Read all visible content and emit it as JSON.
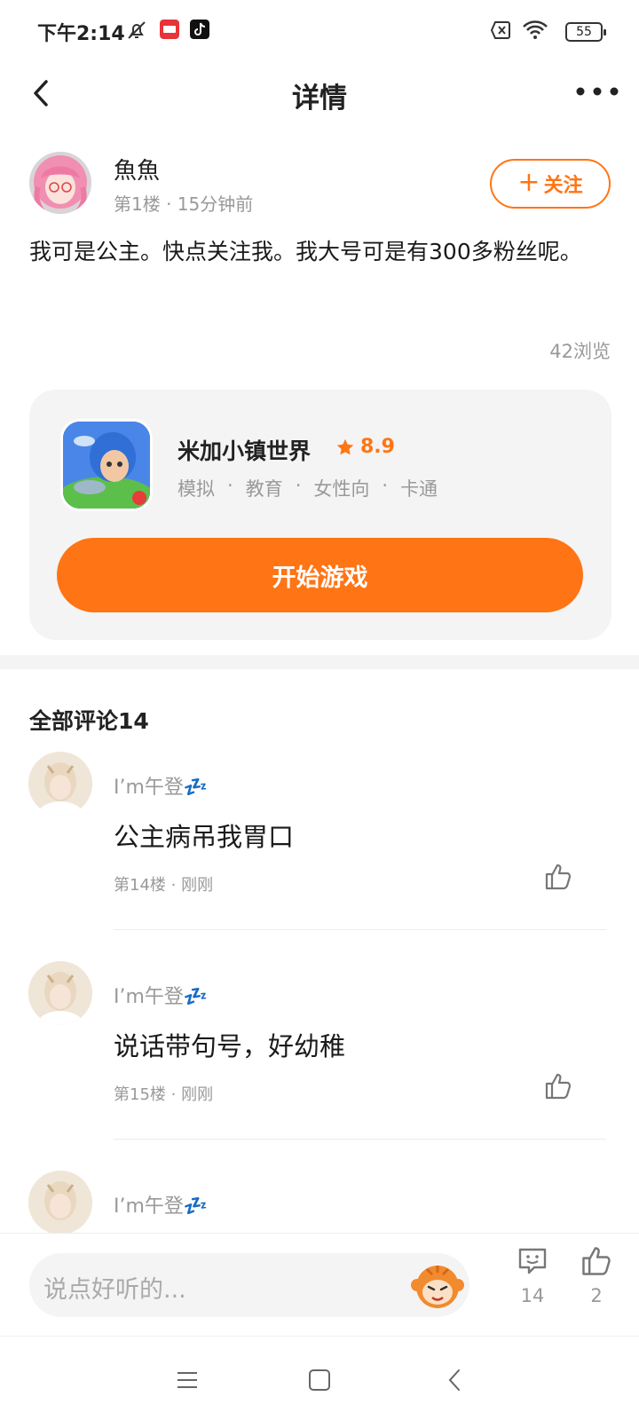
{
  "status_bar": {
    "time": "下午2:14",
    "battery": "55",
    "app_icons": [
      "bell-mute-icon",
      "app-red-icon",
      "tiktok-icon"
    ],
    "right_icons": [
      "no-sim-icon",
      "wifi-icon"
    ]
  },
  "header": {
    "title": "详情",
    "back_icon": "chevron-left-icon",
    "more_icon": "more-dots-icon"
  },
  "post": {
    "author": "魚魚",
    "meta": "第1楼 · 15分钟前",
    "follow_label": "关注",
    "content": "我可是公主。快点关注我。我大号可是有300多粉丝呢。",
    "views": "42浏览"
  },
  "game": {
    "name": "米加小镇世界",
    "rating": "8.9",
    "tags": [
      "模拟",
      "教育",
      "女性向",
      "卡通"
    ],
    "tag_separator": "·",
    "play_label": "开始游戏"
  },
  "comments": {
    "title": "全部评论14",
    "items": [
      {
        "user": "I’m午登💤",
        "text": "公主病吊我胃口",
        "meta": "第14楼 · 刚刚"
      },
      {
        "user": "I’m午登💤",
        "text": "说话带句号，好幼稚",
        "meta": "第15楼 · 刚刚"
      },
      {
        "user": "I’m午登💤",
        "text": "",
        "meta": ""
      }
    ]
  },
  "bottom_bar": {
    "input_placeholder": "说点好听的...",
    "comment_count": "14",
    "like_count": "2"
  },
  "colors": {
    "accent": "#ff7514",
    "muted": "#999999",
    "card_bg": "#f4f4f4"
  }
}
